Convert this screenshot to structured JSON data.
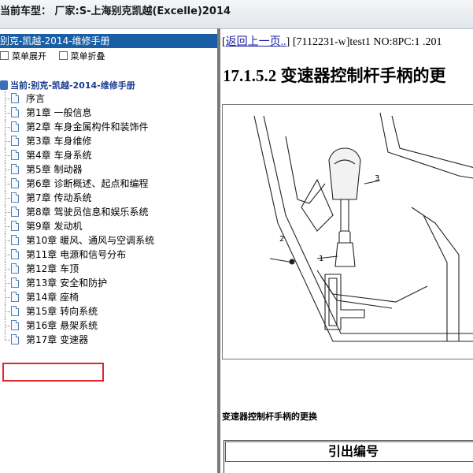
{
  "header": {
    "title": "当前车型： 厂家:S-上海别克凯越(Excelle)2014"
  },
  "sidebar": {
    "manual_title": "别克-凯越-2014-维修手册",
    "expand_label": "菜单展开",
    "collapse_label": "菜单折叠",
    "root_label": "当前:别克-凯越-2014-维修手册",
    "items": [
      {
        "label": "序言"
      },
      {
        "label": "第1章 一般信息"
      },
      {
        "label": "第2章 车身金属构件和装饰件"
      },
      {
        "label": "第3章 车身维修"
      },
      {
        "label": "第4章 车身系统"
      },
      {
        "label": "第5章 制动器"
      },
      {
        "label": "第6章 诊断概述、起点和编程"
      },
      {
        "label": "第7章 传动系统"
      },
      {
        "label": "第8章 驾驶员信息和娱乐系统"
      },
      {
        "label": "第9章 发动机"
      },
      {
        "label": "第10章 暖风、通风与空调系统"
      },
      {
        "label": "第11章 电源和信号分布"
      },
      {
        "label": "第12章 车顶"
      },
      {
        "label": "第13章 安全和防护"
      },
      {
        "label": "第14章 座椅"
      },
      {
        "label": "第15章 转向系统"
      },
      {
        "label": "第16章 悬架系统"
      },
      {
        "label": "第17章 变速器"
      }
    ],
    "selected_index": 17
  },
  "content": {
    "back_link": "返回上一页..",
    "meta": "] [7112231-w]test1 NO:8PC:1 .201",
    "section_title": "17.1.5.2 变速器控制杆手柄的更",
    "figure_callouts": [
      "1",
      "2",
      "3"
    ],
    "caption": "变速器控制杆手柄的更换",
    "table_header": "引出编号"
  },
  "colors": {
    "header_bar": "#1a5fa6",
    "highlight_box": "#e0262a",
    "link": "#1a1aa6"
  }
}
